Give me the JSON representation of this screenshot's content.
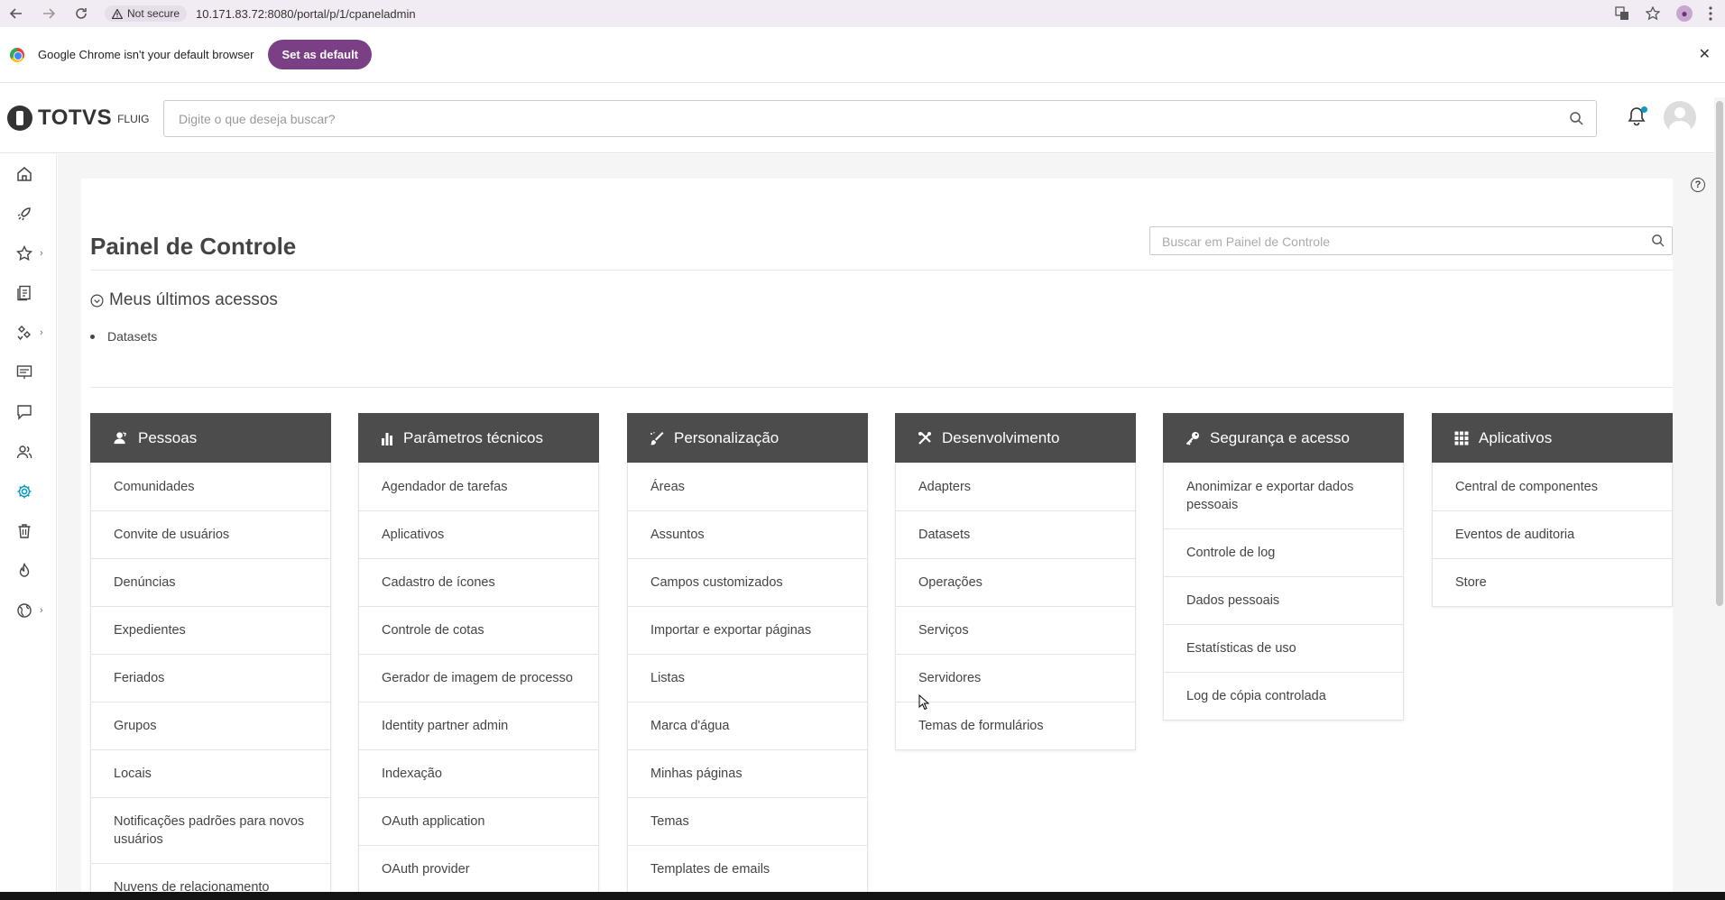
{
  "browser": {
    "not_secure": "Not secure",
    "url": "10.171.83.72:8080/portal/p/1/cpaneladmin"
  },
  "infobar": {
    "message": "Google Chrome isn't your default browser",
    "button": "Set as default"
  },
  "header": {
    "brand": "TOTVS",
    "brand_sub": "FLUIG",
    "search_placeholder": "Digite o que deseja buscar?"
  },
  "page": {
    "title": "Painel de Controle",
    "search_placeholder": "Buscar em Painel de Controle",
    "recent_title": "Meus últimos acessos",
    "recent_items": [
      "Datasets"
    ]
  },
  "columns": [
    {
      "title": "Pessoas",
      "icon": "people-icon",
      "items": [
        "Comunidades",
        "Convite de usuários",
        "Denúncias",
        "Expedientes",
        "Feriados",
        "Grupos",
        "Locais",
        "Notificações padrões para novos usuários",
        "Nuvens de relacionamento"
      ]
    },
    {
      "title": "Parâmetros técnicos",
      "icon": "bar-chart-icon",
      "items": [
        "Agendador de tarefas",
        "Aplicativos",
        "Cadastro de ícones",
        "Controle de cotas",
        "Gerador de imagem de processo",
        "Identity partner admin",
        "Indexação",
        "OAuth application",
        "OAuth provider"
      ]
    },
    {
      "title": "Personalização",
      "icon": "paint-icon",
      "items": [
        "Áreas",
        "Assuntos",
        "Campos customizados",
        "Importar e exportar páginas",
        "Listas",
        "Marca d'água",
        "Minhas páginas",
        "Temas",
        "Templates de emails"
      ]
    },
    {
      "title": "Desenvolvimento",
      "icon": "tools-icon",
      "items": [
        "Adapters",
        "Datasets",
        "Operações",
        "Serviços",
        "Servidores",
        "Temas de formulários"
      ]
    },
    {
      "title": "Segurança e acesso",
      "icon": "key-icon",
      "items": [
        "Anonimizar e exportar dados pessoais",
        "Controle de log",
        "Dados pessoais",
        "Estatísticas de uso",
        "Log de cópia controlada"
      ]
    },
    {
      "title": "Aplicativos",
      "icon": "grid-icon",
      "items": [
        "Central de componentes",
        "Eventos de auditoria",
        "Store"
      ]
    }
  ],
  "colors": {
    "column_header": "#4c4c4c",
    "accent": "#0c9abe",
    "chrome_button": "#7b3f86"
  }
}
